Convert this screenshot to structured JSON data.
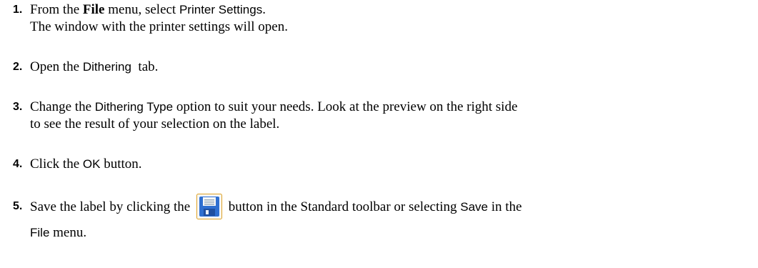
{
  "steps": [
    {
      "number": "1.",
      "pre": "From the ",
      "menu": "File",
      "mid": " menu, select ",
      "item": "Printer Settings",
      "post": ".",
      "line2": "The window with the printer settings will open."
    },
    {
      "number": "2.",
      "pre": "Open the ",
      "ui": "Dithering",
      "post": "  tab."
    },
    {
      "number": "3.",
      "pre": "Change the ",
      "ui": "Dithering Type",
      "post": " option to suit your needs. Look at the preview on the right side",
      "line2": "to see the result of your selection on the label."
    },
    {
      "number": "4.",
      "pre": "Click the ",
      "ui": "OK",
      "post": " button."
    },
    {
      "number": "5.",
      "pre": "Save the label by clicking the ",
      "icon": "floppy-disk-save-icon",
      "mid": " button in the Standard toolbar or selecting ",
      "ui": "Save",
      "post": " in the",
      "line2_ui": "File",
      "line2_post": " menu."
    }
  ],
  "colors": {
    "icon_blue": "#2f6fd0",
    "icon_border": "#e0a020"
  }
}
